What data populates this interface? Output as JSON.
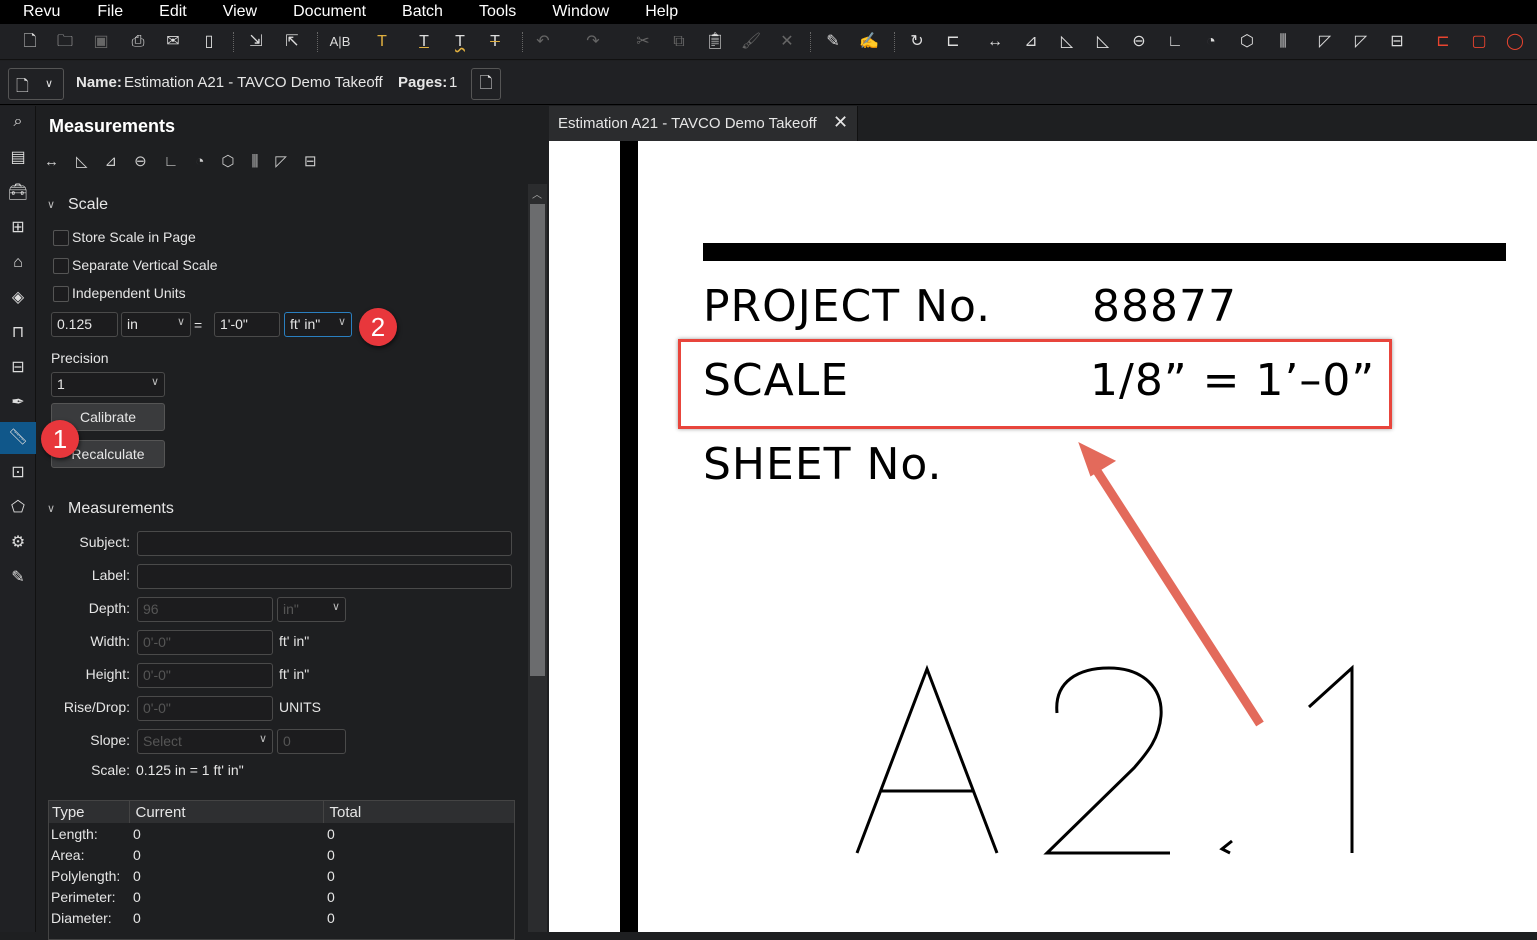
{
  "menu": [
    "Revu",
    "File",
    "Edit",
    "View",
    "Document",
    "Batch",
    "Tools",
    "Window",
    "Help"
  ],
  "toolbar_icons": [
    "new-document-icon",
    "open-icon",
    "save-icon",
    "print-icon",
    "email-icon",
    "notebook-icon",
    "import-icon",
    "export-icon",
    "spell-check-icon",
    "text-markup-icon",
    "underline-icon",
    "squiggly-icon",
    "strikethrough-icon",
    "undo-icon",
    "redo-icon",
    "cut-icon",
    "copy-icon",
    "paste-icon",
    "format-painter-icon",
    "delete-icon",
    "measure-tools-icons"
  ],
  "docbar": {
    "name_label": "Name:",
    "name_value": "Estimation A21 - TAVCO Demo Takeoff",
    "pages_label": "Pages:",
    "pages_value": "1"
  },
  "panel": {
    "title": "Measurements",
    "scale_section": "Scale",
    "checkboxes": [
      {
        "label": "Store Scale in Page",
        "checked": false
      },
      {
        "label": "Separate Vertical Scale",
        "checked": false
      },
      {
        "label": "Independent Units",
        "checked": false
      }
    ],
    "scale_value": "0.125",
    "scale_unit": "in",
    "equals": "=",
    "real_value": "1'-0\"",
    "real_unit": "ft' in\"",
    "precision_label": "Precision",
    "precision_value": "1",
    "calibrate": "Calibrate",
    "recalculate": "Recalculate",
    "measurements_section": "Measurements",
    "fields": {
      "subject": "Subject:",
      "label": "Label:",
      "depth": "Depth:",
      "depth_value": "96",
      "depth_unit": "in\"",
      "width": "Width:",
      "width_value": "0'-0\"",
      "width_unit": "ft' in\"",
      "height": "Height:",
      "height_value": "0'-0\"",
      "height_unit": "ft' in\"",
      "rise": "Rise/Drop:",
      "rise_value": "0'-0\"",
      "rise_unit": "UNITS",
      "slope": "Slope:",
      "slope_value": "Select",
      "slope_num": "0",
      "scale": "Scale:",
      "scale_text": "0.125 in = 1 ft' in\""
    },
    "table": {
      "headers": [
        "Type",
        "Current",
        "Total"
      ],
      "rows": [
        [
          "Length:",
          "0",
          "0"
        ],
        [
          "Area:",
          "0",
          "0"
        ],
        [
          "Polylength:",
          "0",
          "0"
        ],
        [
          "Perimeter:",
          "0",
          "0"
        ],
        [
          "Diameter:",
          "0",
          "0"
        ]
      ]
    }
  },
  "badges": [
    "1",
    "2"
  ],
  "tab": {
    "title": "Estimation A21 - TAVCO Demo Takeoff"
  },
  "drawing": {
    "project": "PROJECT  No.",
    "project_no": "88877",
    "scale": "SCALE",
    "scale_value": "1/8” = 1’–0”",
    "sheet": "SHEET  No.",
    "sheet_no": "A2.1"
  },
  "colors": {
    "accent": "#10578a",
    "badge": "#e8373c",
    "highlight": "#e8453c"
  }
}
